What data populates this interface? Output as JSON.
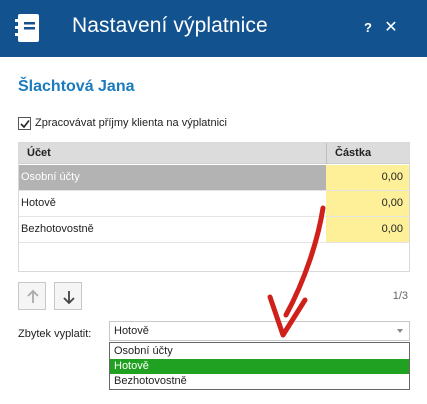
{
  "window": {
    "title": "Nastavení výplatnice",
    "help_label": "?",
    "close_label": "✕",
    "app_icon": "notebook-icon",
    "colors": {
      "titlebar": "#12538f",
      "accent_text": "#1a7bbf",
      "amount_cell": "#fdf099",
      "selected_row": "#b3b3b3",
      "dropdown_active": "#21a121",
      "annotation": "#d0201a"
    }
  },
  "client": {
    "name": "Šlachtová Jana"
  },
  "process_income": {
    "label": "Zpracovávat příjmy klienta na výplatnici",
    "checked": true
  },
  "grid": {
    "headers": {
      "account": "Účet",
      "amount": "Částka"
    },
    "rows": [
      {
        "account": "Osobní účty",
        "amount": "0,00",
        "selected": true
      },
      {
        "account": "Hotově",
        "amount": "0,00",
        "selected": false
      },
      {
        "account": "Bezhotovostně",
        "amount": "0,00",
        "selected": false
      }
    ]
  },
  "pager": {
    "move_up_icon": "arrow-up-icon",
    "move_down_icon": "arrow-down-icon",
    "position": "1/3"
  },
  "remainder": {
    "label": "Zbytek vyplatit:",
    "selected": "Hotově",
    "options": [
      "Osobní účty",
      "Hotově",
      "Bezhotovostně"
    ],
    "highlighted_index": 1
  }
}
